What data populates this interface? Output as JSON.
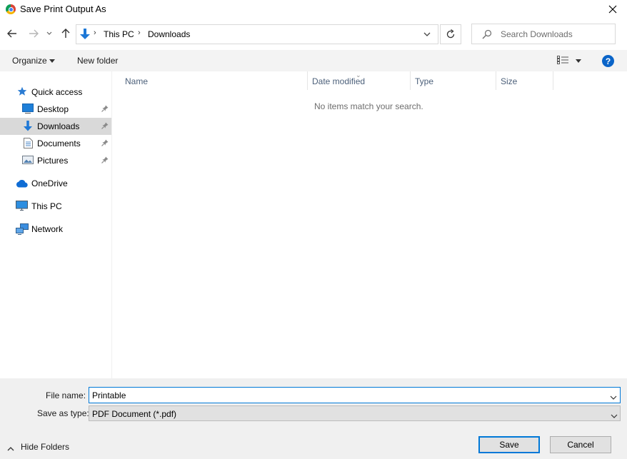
{
  "window": {
    "title": "Save Print Output As",
    "close_glyph": "✕"
  },
  "nav": {
    "back_glyph": "←",
    "forward_glyph": "→",
    "recent_glyph": "⌄",
    "up_glyph": "↑"
  },
  "address": {
    "crumbs": [
      "This PC",
      "Downloads"
    ],
    "separator": "›",
    "dropdown_glyph": "⌄",
    "refresh_glyph": "↻"
  },
  "search": {
    "placeholder": "Search Downloads"
  },
  "toolbar": {
    "organize_label": "Organize",
    "new_folder_label": "New folder",
    "help_label": "?"
  },
  "sidebar": {
    "items": [
      {
        "label": "Quick access",
        "icon": "star-icon",
        "pinned": false
      },
      {
        "label": "Desktop",
        "icon": "desktop-icon",
        "pinned": true
      },
      {
        "label": "Downloads",
        "icon": "download-arrow-icon",
        "pinned": true,
        "selected": true
      },
      {
        "label": "Documents",
        "icon": "document-icon",
        "pinned": true
      },
      {
        "label": "Pictures",
        "icon": "pictures-icon",
        "pinned": true
      },
      {
        "label": "OneDrive",
        "icon": "cloud-icon",
        "pinned": false
      },
      {
        "label": "This PC",
        "icon": "computer-icon",
        "pinned": false
      },
      {
        "label": "Network",
        "icon": "network-icon",
        "pinned": false
      }
    ]
  },
  "filelist": {
    "columns": [
      "Name",
      "Date modified",
      "Type",
      "Size"
    ],
    "empty_message": "No items match your search."
  },
  "form": {
    "file_name_label": "File name:",
    "file_name_value": "Printable",
    "save_as_type_label": "Save as type:",
    "save_as_type_value": "PDF Document (*.pdf)"
  },
  "footer": {
    "hide_folders_label": "Hide Folders",
    "save_label": "Save",
    "cancel_label": "Cancel"
  },
  "colors": {
    "accent": "#0078d7",
    "selected_bg": "#d9d9d9",
    "column_header_text": "#4c607a"
  }
}
